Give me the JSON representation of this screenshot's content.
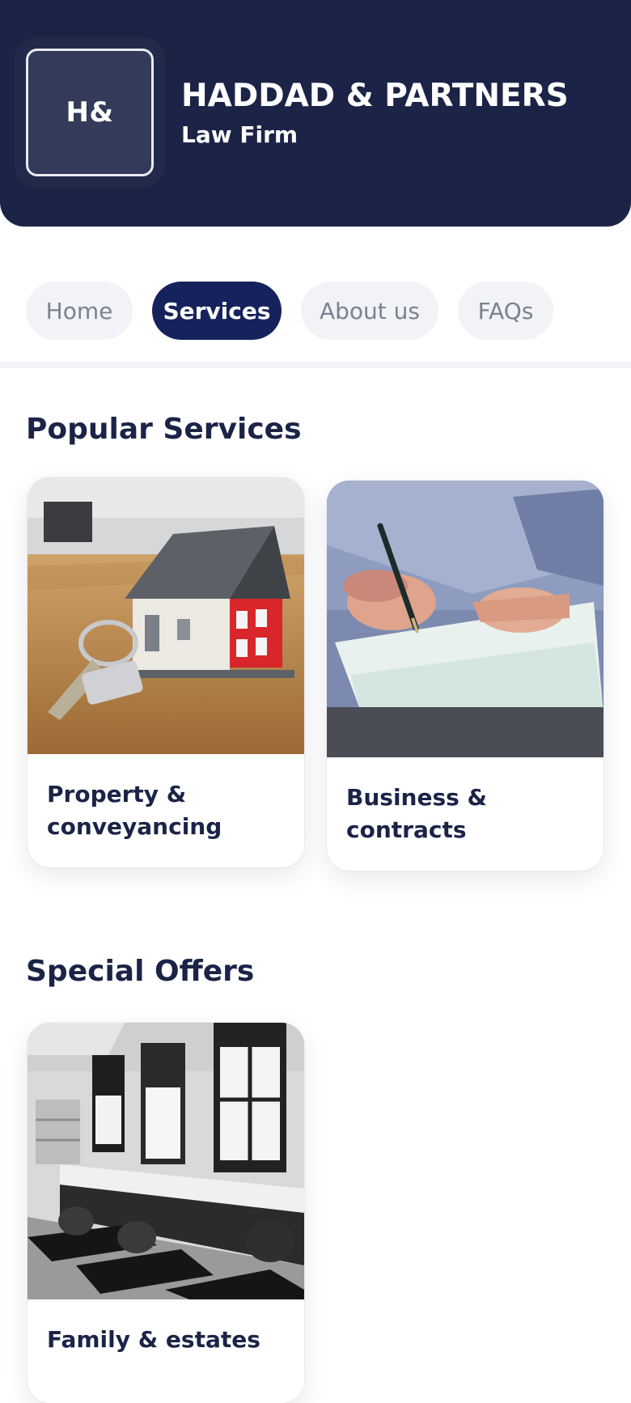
{
  "header": {
    "logo_initials": "H&",
    "firm_name": "HADDAD & PARTNERS",
    "firm_type": "Law Firm"
  },
  "nav": {
    "tabs": [
      {
        "label": "Home",
        "active": false
      },
      {
        "label": "Services",
        "active": true
      },
      {
        "label": "About us",
        "active": false
      },
      {
        "label": "FAQs",
        "active": false
      }
    ]
  },
  "popular_services": {
    "title": "Popular Services",
    "cards": [
      {
        "label": "Property & conveyancing",
        "image": "house-model-with-keys"
      },
      {
        "label": "Business & contracts",
        "image": "hand-signing-document"
      }
    ]
  },
  "special_offers": {
    "title": "Special Offers",
    "cards": [
      {
        "label": "Family & estates",
        "image": "salon-interior-black-and-white"
      }
    ]
  },
  "colors": {
    "primary": "#1b2447",
    "active_tab": "#16225b",
    "tab_bg": "#f2f3f7",
    "tab_text": "#7c8190"
  }
}
